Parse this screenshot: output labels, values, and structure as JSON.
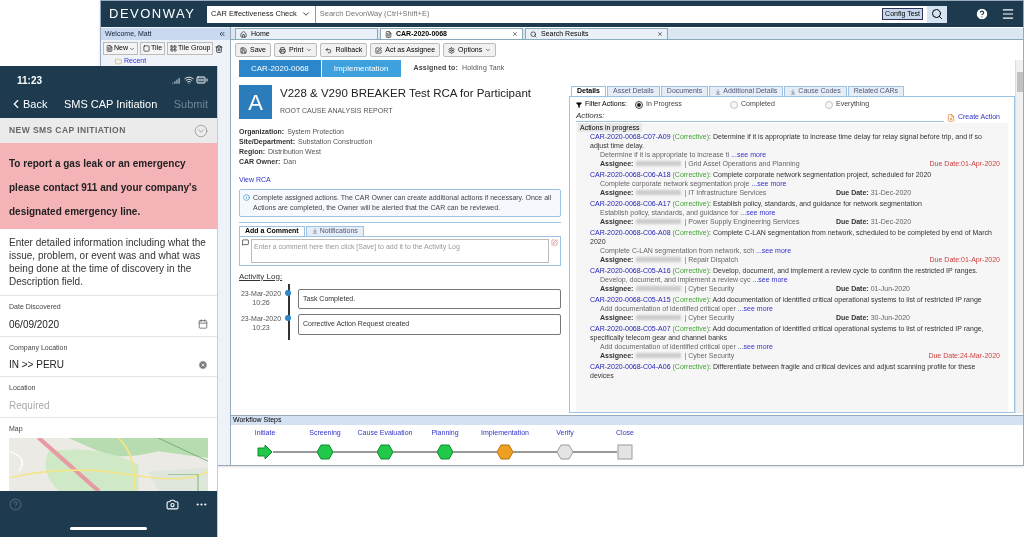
{
  "app": {
    "logo": "DEVONWAY",
    "context_select": "CAR Effectiveness Check",
    "search": {
      "placeholder": "Search DevonWay (Ctrl+Shift+E)"
    },
    "environment_badge": "Config Test"
  },
  "sidebar": {
    "welcome": "Welcome, Matt",
    "buttons": [
      {
        "label": "New",
        "menu": true
      },
      {
        "label": "Tile",
        "menu": false
      },
      {
        "label": "Tile Group",
        "menu": false
      }
    ],
    "recent": "Recent"
  },
  "tabs": [
    {
      "label": "Home",
      "selected": false,
      "closable": false
    },
    {
      "label": "CAR-2020-0068",
      "selected": true,
      "closable": true
    },
    {
      "label": "Search Results",
      "selected": false,
      "closable": true
    }
  ],
  "toolbar": [
    {
      "label": "Save",
      "menu": false
    },
    {
      "label": "Print",
      "menu": true
    },
    {
      "label": "Rollback",
      "menu": false
    },
    {
      "label": "Act as Assignee",
      "menu": false
    },
    {
      "label": "Options",
      "menu": true
    }
  ],
  "record": {
    "breadcrumb": [
      "CAR-2020-0068",
      "Implementation"
    ],
    "assigned_label": "Assigned to:",
    "assigned_value": "Holding Tank",
    "avatar_letter": "A",
    "title": "V228 & V290 BREAKER Test RCA for Participant",
    "subtitle": "ROOT CAUSE ANALYSIS REPORT",
    "fields": [
      {
        "label": "Organization:",
        "value": "System Protection"
      },
      {
        "label": "Site/Department:",
        "value": "Substation Construction"
      },
      {
        "label": "Region:",
        "value": "Distribution West"
      },
      {
        "label": "CAR Owner:",
        "value": "Dan"
      }
    ],
    "link": "View RCA",
    "info": "Complete assigned actions. The CAR Owner can create additional actions if necessary. Once all Actions are completed, the Owner will be alerted that the CAR can be reviewed."
  },
  "comment": {
    "tabs": [
      {
        "label": "Add a Comment",
        "selected": true
      },
      {
        "label": "Notifications",
        "selected": false
      }
    ],
    "placeholder": "Enter a comment here then click [Save] to add it to the Activity Log"
  },
  "activity_log": {
    "title": "Activity Log:",
    "entries": [
      {
        "date": "23-Mar-2020",
        "time": "10:26",
        "text": "Task Completed."
      },
      {
        "date": "23-Mar-2020",
        "time": "10:23",
        "text": "Corrective Action Request created"
      }
    ]
  },
  "detail_tabs": [
    {
      "label": "Details",
      "selected": true
    },
    {
      "label": "Asset Details",
      "selected": false
    },
    {
      "label": "Documents",
      "selected": false
    },
    {
      "label": "Additional Details",
      "selected": false
    },
    {
      "label": "Cause Codes",
      "selected": false
    },
    {
      "label": "Related CARs",
      "selected": false
    }
  ],
  "filter": {
    "label": "Filter Actions:",
    "options": [
      {
        "label": "In Progress",
        "selected": true
      },
      {
        "label": "Completed",
        "selected": false
      },
      {
        "label": "Everything",
        "selected": false
      }
    ]
  },
  "actions": {
    "title": "Actions:",
    "create": "Create Action",
    "group": "Actions in progress",
    "items": [
      {
        "id": "CAR-2020-0068-C07-A09",
        "type": "(Corrective)",
        "title": ": Determine if it is appropriate to increase time delay for relay signal before trip, and if so adjust time delay.",
        "summary": "Determine if it is appropriate to increase ti",
        "more": "...see more",
        "assignee_label": "Assignee:",
        "department": "| Grid Asset Operations and Planning",
        "due_label": "Due Date:",
        "due": "01-Apr-2020",
        "overdue": true
      },
      {
        "id": "CAR-2020-0068-C06-A18",
        "type": "(Corrective)",
        "title": ": Complete corporate network segmentation project, scheduled for 2020",
        "summary": "Complete corporate network segmentation proje",
        "more": "...see more",
        "assignee_label": "Assignee:",
        "department": "| IT Infrastructure Services",
        "due_label": "Due Date:",
        "due": "31-Dec-2020",
        "overdue": false
      },
      {
        "id": "CAR-2020-0068-C06-A17",
        "type": "(Corrective)",
        "title": ": Establish policy, standards, and guidance for network segmentation",
        "summary": "Establish policy, standards, and guidance for",
        "more": "...see more",
        "assignee_label": "Assignee:",
        "department": "| Power Supply Engineering Services",
        "due_label": "Due Date:",
        "due": "31-Dec-2020",
        "overdue": false
      },
      {
        "id": "CAR-2020-0068-C06-A08",
        "type": "(Corrective)",
        "title": ": Complete C-LAN segmentation from network, scheduled to be completed by end of March 2020",
        "summary": "Complete C-LAN segmentation from network, sch",
        "more": "...see more",
        "assignee_label": "Assignee:",
        "department": "| Repair Dispatch",
        "due_label": "Due Date:",
        "due": "01-Apr-2020",
        "overdue": true
      },
      {
        "id": "CAR-2020-0068-C05-A16",
        "type": "(Corrective)",
        "title": ": Develop, document, and implement a review cycle to confirm the restricted IP ranges.",
        "summary": "Develop, document, and implement a review cyc",
        "more": "...see more",
        "assignee_label": "Assignee:",
        "department": "| Cyber Security",
        "due_label": "Due Date:",
        "due": "01-Jun-2020",
        "overdue": false
      },
      {
        "id": "CAR-2020-0068-C05-A15",
        "type": "(Corrective)",
        "title": ": Add documentation of identified critical operational systems to list of restricted IP range",
        "summary": "Add documentation of identified critical oper",
        "more": "...see more",
        "assignee_label": "Assignee:",
        "department": "| Cyber Security",
        "due_label": "Due Date:",
        "due": "30-Jun-2020",
        "overdue": false
      },
      {
        "id": "CAR-2020-0068-C05-A07",
        "type": "(Corrective)",
        "title": ": Add documentation of identified critical operational systems to list of restricted IP range, specifically telecom gear and channel banks",
        "summary": "Add documentation of identified critical oper",
        "more": "...see more",
        "assignee_label": "Assignee:",
        "department": "| Cyber Security",
        "due_label": "Due Date:",
        "due": "24-Mar-2020",
        "overdue": true
      },
      {
        "id": "CAR-2020-0068-C04-A06",
        "type": "(Corrective)",
        "title": ": Differentiate between fragile and critical devices and adjust scanning profile for these devices"
      }
    ]
  },
  "workflow": {
    "title": "Workflow Steps",
    "steps": [
      {
        "label": "Initiate",
        "done": true,
        "current": false
      },
      {
        "label": "Screening",
        "done": true,
        "current": false
      },
      {
        "label": "Cause Evaluation",
        "done": true,
        "current": false
      },
      {
        "label": "Planning",
        "done": true,
        "current": false
      },
      {
        "label": "Implementation",
        "done": false,
        "current": true
      },
      {
        "label": "Verify",
        "done": false,
        "current": false
      },
      {
        "label": "Close",
        "done": false,
        "current": false
      }
    ]
  },
  "mobile": {
    "time": "11:23",
    "back": "Back",
    "title": "SMS CAP Initiation",
    "submit": {
      "label": "Submit",
      "disabled": true
    },
    "section": "NEW SMS CAP INITIATION",
    "alert": "To report a gas leak or an emergency please contact 911 and your company's designated emergency line.",
    "instructions": "Enter detailed information including what the issue, problem, or event was and what was being done at the time of discovery in the Description field.",
    "fields": [
      {
        "kind": "date",
        "label": "Date Discovered",
        "value": "06/09/2020"
      },
      {
        "kind": "clearable",
        "label": "Company Location",
        "value": "IN >> PERU"
      },
      {
        "kind": "text",
        "label": "Location",
        "placeholder": "Required"
      }
    ],
    "map_label": "Map"
  }
}
